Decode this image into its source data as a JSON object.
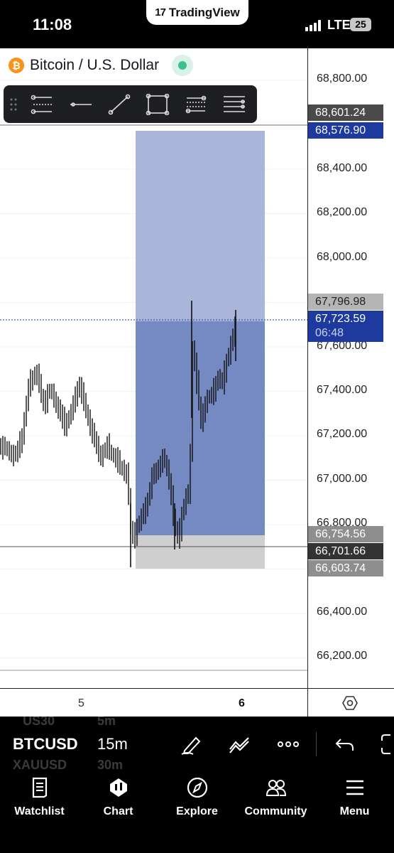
{
  "status_bar": {
    "time": "11:08",
    "app_pill": "TradingView",
    "network": "LTE",
    "battery": "25"
  },
  "chart_header": {
    "symbol_name": "Bitcoin / U.S. Dollar",
    "currency_icon": "bitcoin-icon"
  },
  "drawing_toolbar": {
    "tools": [
      "horizontal-ray-grid-icon",
      "horizontal-line-icon",
      "trend-line-icon",
      "rectangle-icon",
      "parallel-channel-icon",
      "fib-levels-icon"
    ]
  },
  "price_scale": {
    "ticks": [
      "68,800.00",
      "68,400.00",
      "68,200.00",
      "68,000.00",
      "67,600.00",
      "67,400.00",
      "67,200.00",
      "67,000.00",
      "66,800.00",
      "66,400.00",
      "66,200.00"
    ],
    "labels": [
      {
        "value": "68,601.24",
        "bg": "#4a4a4a"
      },
      {
        "value": "68,576.90",
        "bg": "#1e3a9e"
      },
      {
        "value": "67,796.98",
        "bg": "#b5b5b5"
      },
      {
        "value": "66,754.56",
        "bg": "#8e8e8e"
      },
      {
        "value": "66,701.66",
        "bg": "#333333"
      },
      {
        "value": "66,603.74",
        "bg": "#8e8e8e"
      }
    ],
    "current_price": "67,723.59",
    "countdown": "06:48",
    "current_bg": "#1e3a9e"
  },
  "time_axis": {
    "day_5": "5",
    "day_6": "6"
  },
  "symbol_bar": {
    "ghost_top": [
      "US30",
      "5m"
    ],
    "ghost_bottom": [
      "XAUUSD",
      "30m"
    ],
    "symbol": "BTCUSD",
    "interval": "15m"
  },
  "bottom_nav": [
    {
      "label": "Watchlist",
      "icon": "watchlist-icon"
    },
    {
      "label": "Chart",
      "icon": "chart-icon"
    },
    {
      "label": "Explore",
      "icon": "compass-icon"
    },
    {
      "label": "Community",
      "icon": "community-icon"
    },
    {
      "label": "Menu",
      "icon": "menu-icon"
    }
  ],
  "colors": {
    "target_zone": "#a9b6d9",
    "entry_zone": "#7589c2",
    "stop_zone": "#cfcfcf",
    "candle": "#111111",
    "accent_blue": "#1e3a9e"
  }
}
